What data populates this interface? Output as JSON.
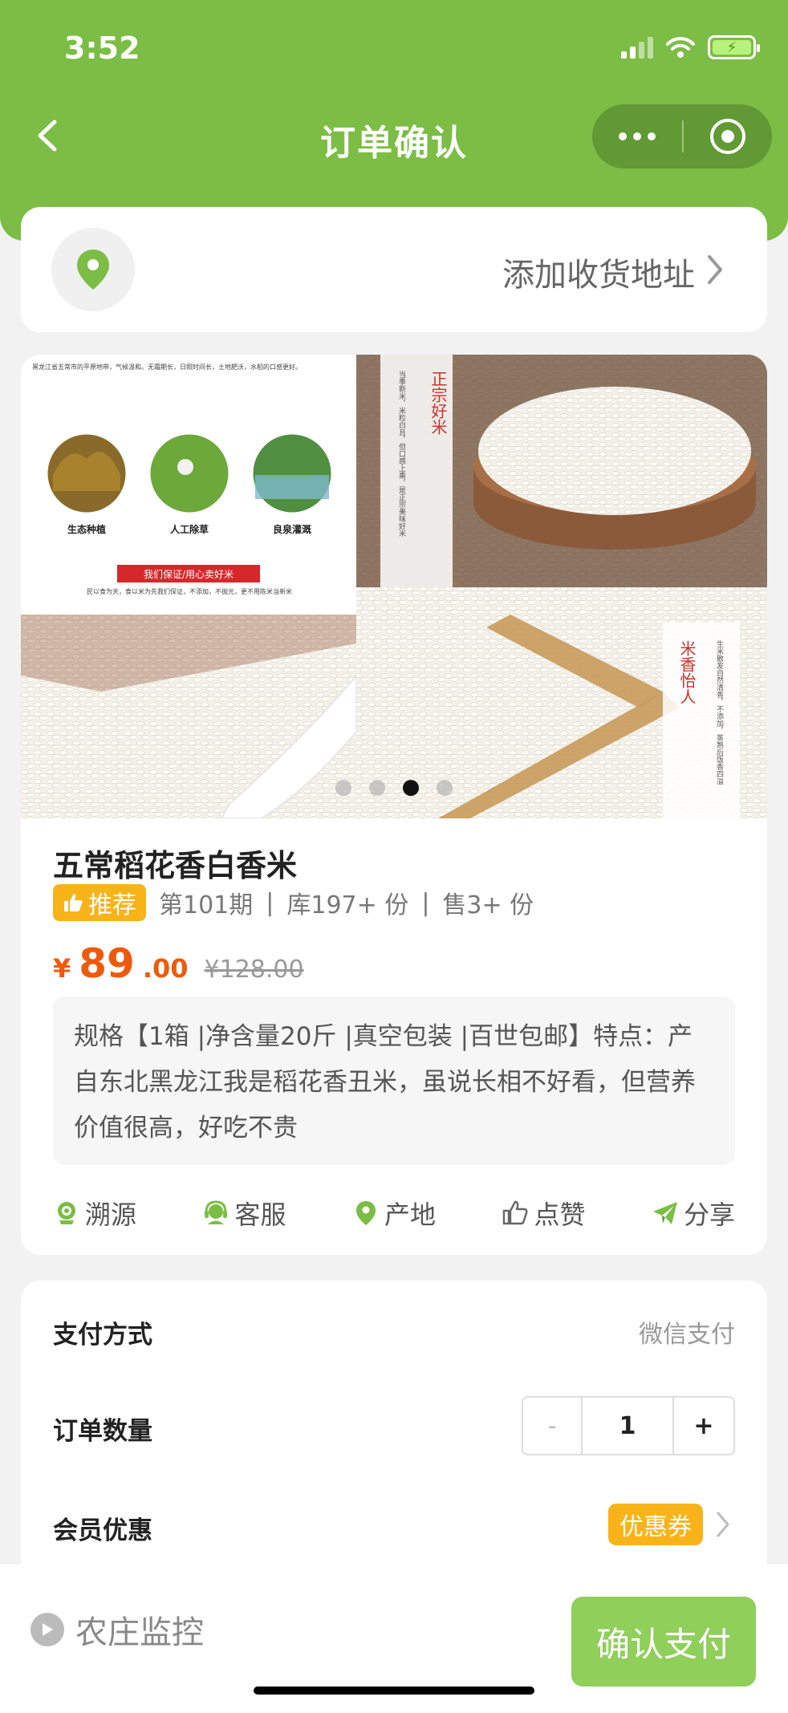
{
  "status_bar": {
    "time": "3:52"
  },
  "nav": {
    "title": "订单确认"
  },
  "address": {
    "placeholder": "添加收货地址"
  },
  "banner": {
    "panel1": {
      "intro": "黑龙江省五常市的平原地带，气候温和。无霜期长，日照时间长，土地肥沃，水稻的口感更好。",
      "features": [
        "生态种植",
        "人工除草",
        "良泉灌溉"
      ],
      "slogan": "我们保证/用心卖好米",
      "foot": "民以食为天，食以米为先我们保证，不添加，不抛光，更不用陈米当新米"
    },
    "panel2": {
      "vertical_title": "正宗好米",
      "vertical_desc": "当季新米，米粒白且，但口感上乘，是正宗美味好米"
    },
    "panel4": {
      "vertical_title": "米香怡人",
      "vertical_desc": "生米散发自然清香，不添加，蒸熟后饭香四溢"
    },
    "dot_count": 4,
    "active_dot": 2
  },
  "product": {
    "title": "五常稻花香白香米",
    "badge": "推荐",
    "period": "第101期",
    "stock": "库197+ 份",
    "sold": "售3+ 份",
    "price_symbol": "¥",
    "price_int": "89",
    "price_dec": ".00",
    "price_old": "¥128.00",
    "description": "规格【1箱 |净含量20斤 |真空包装 |百世包邮】特点：产自东北黑龙江我是稻花香丑米，虽说长相不好看，但营养价值很高，好吃不贵"
  },
  "actions": [
    {
      "label": "溯源",
      "icon": "trace-icon"
    },
    {
      "label": "客服",
      "icon": "service-icon"
    },
    {
      "label": "产地",
      "icon": "location-icon"
    },
    {
      "label": "点赞",
      "icon": "thumb-up-icon"
    },
    {
      "label": "分享",
      "icon": "share-icon"
    }
  ],
  "order": {
    "payment_label": "支付方式",
    "payment_value": "微信支付",
    "quantity_label": "订单数量",
    "minus": "-",
    "quantity": "1",
    "plus": "+",
    "member_label": "会员优惠",
    "coupon": "优惠券"
  },
  "bottom": {
    "monitor": "农庄监控",
    "pay": "确认支付"
  },
  "colors": {
    "brand_green": "#7cbd45",
    "accent_orange": "#ee5a0c",
    "badge_yellow": "#f8b319"
  }
}
